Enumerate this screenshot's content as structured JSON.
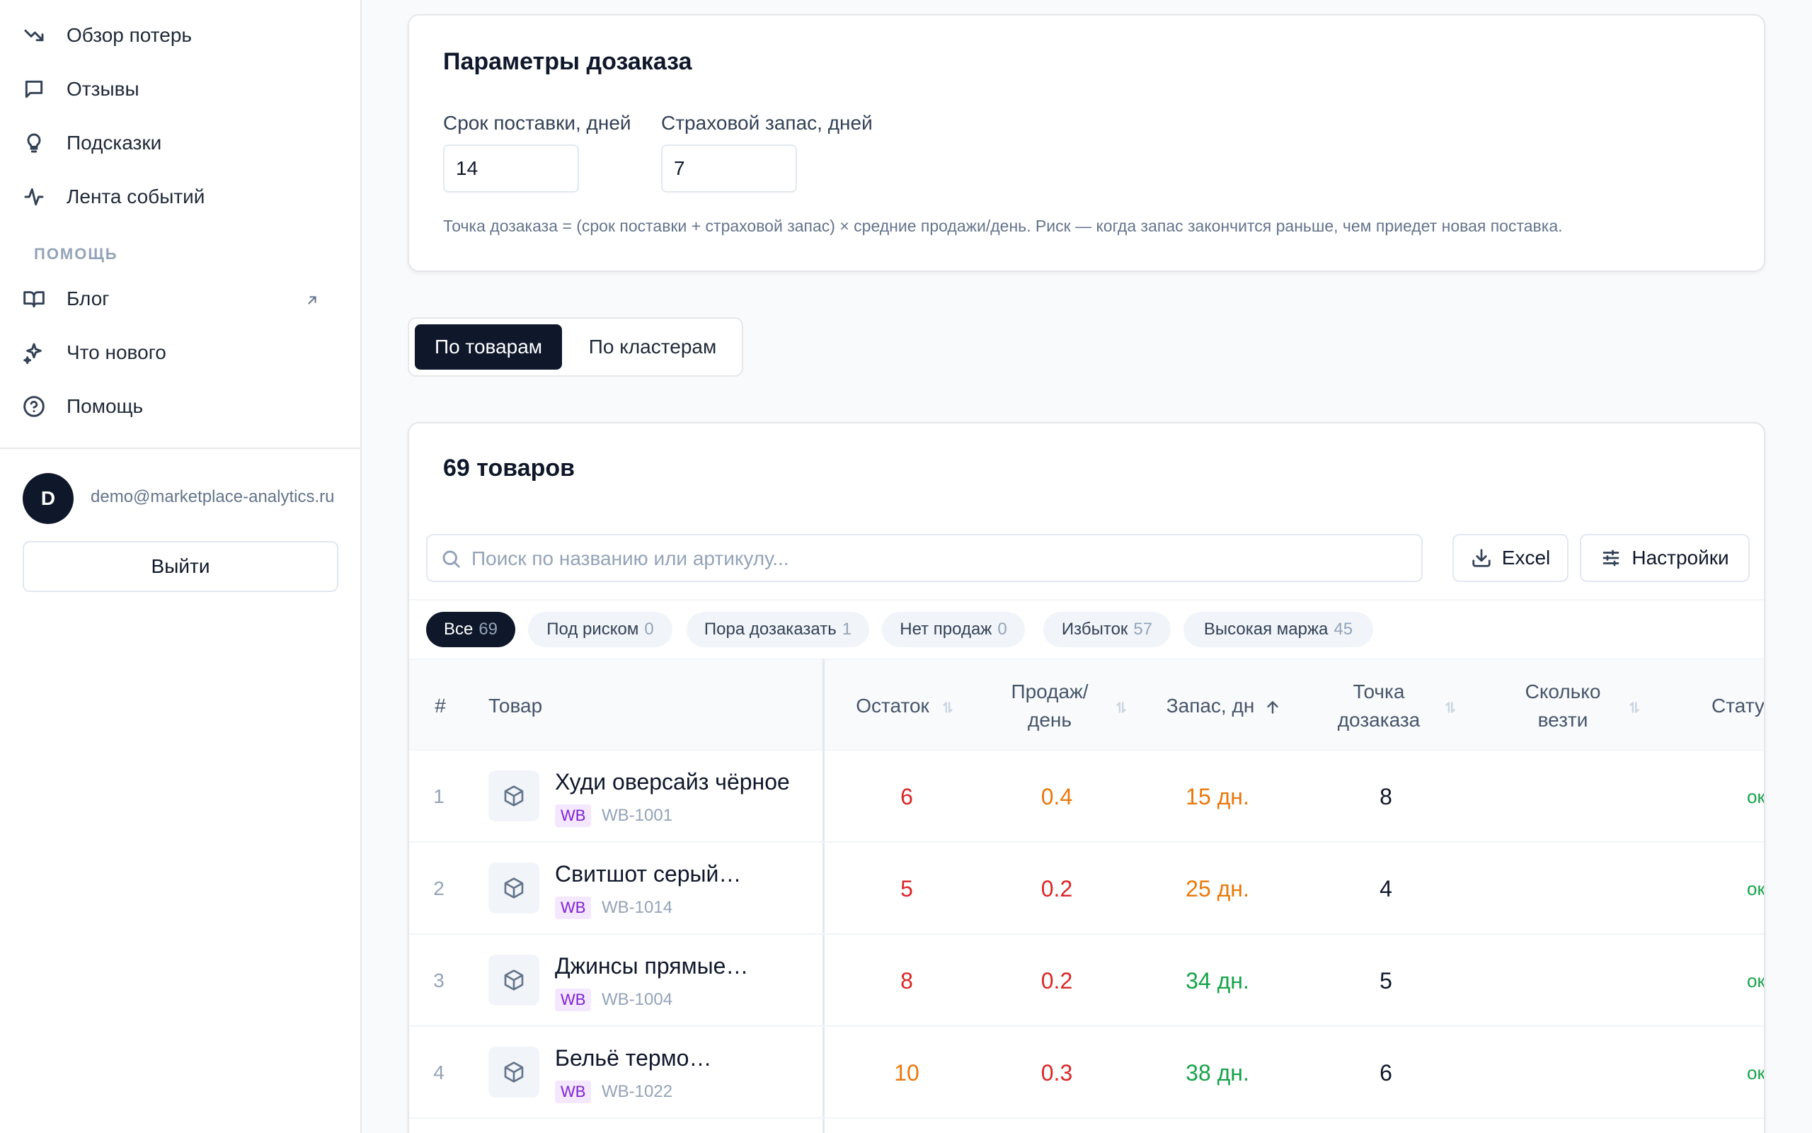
{
  "sidebar": {
    "nav": [
      {
        "label": "Обзор потерь",
        "icon": "trending-down-icon"
      },
      {
        "label": "Отзывы",
        "icon": "message-square-icon"
      },
      {
        "label": "Подсказки",
        "icon": "lightbulb-icon"
      },
      {
        "label": "Лента событий",
        "icon": "activity-icon"
      }
    ],
    "help_section_label": "ПОМОЩЬ",
    "help": [
      {
        "label": "Блог",
        "icon": "book-icon",
        "external": true
      },
      {
        "label": "Что нового",
        "icon": "sparkles-icon"
      },
      {
        "label": "Помощь",
        "icon": "help-circle-icon"
      }
    ],
    "user": {
      "initial": "D",
      "email": "demo@marketplace-analytics.ru"
    },
    "logout_label": "Выйти"
  },
  "params": {
    "title": "Параметры дозаказа",
    "lead_time_label": "Срок поставки, дней",
    "lead_time_value": "14",
    "safety_label": "Страховой запас, дней",
    "safety_value": "7",
    "hint": "Точка дозаказа = (срок поставки + страховой запас) × средние продажи/день. Риск — когда запас закончится раньше, чем приедет новая поставка."
  },
  "tabs": {
    "by_products": "По товарам",
    "by_clusters": "По кластерам"
  },
  "table": {
    "count_title": "69 товаров",
    "search_placeholder": "Поиск по названию или артикулу...",
    "excel_label": "Excel",
    "settings_label": "Настройки",
    "filters": [
      {
        "label": "Все",
        "count": "69",
        "active": true
      },
      {
        "label": "Под риском",
        "count": "0"
      },
      {
        "label": "Пора дозаказать",
        "count": "1"
      },
      {
        "label": "Нет продаж",
        "count": "0"
      },
      {
        "label": "Избыток",
        "count": "57"
      },
      {
        "label": "Высокая маржа",
        "count": "45"
      }
    ],
    "columns": {
      "num": "#",
      "product": "Товар",
      "stock": "Остаток",
      "sales": "Продаж/ день",
      "days": "Запас, дн",
      "reorder": "Точка дозаказа",
      "ship": "Сколько везти",
      "status": "Статус"
    },
    "rows": [
      {
        "num": "1",
        "name": "Худи оверсайз чёрное",
        "mp": "WB",
        "sku": "WB-1001",
        "stock": "6",
        "sales": "0.4",
        "days": "15 дн.",
        "reorder": "8",
        "ship": "",
        "status": "ок"
      },
      {
        "num": "2",
        "name": "Свитшот серый…",
        "mp": "WB",
        "sku": "WB-1014",
        "stock": "5",
        "sales": "0.2",
        "days": "25 дн.",
        "reorder": "4",
        "ship": "",
        "status": "ок"
      },
      {
        "num": "3",
        "name": "Джинсы прямые…",
        "mp": "WB",
        "sku": "WB-1004",
        "stock": "8",
        "sales": "0.2",
        "days": "34 дн.",
        "reorder": "5",
        "ship": "",
        "status": "ок"
      },
      {
        "num": "4",
        "name": "Бельё термо…",
        "mp": "WB",
        "sku": "WB-1022",
        "stock": "10",
        "sales": "0.3",
        "days": "38 дн.",
        "reorder": "6",
        "ship": "",
        "status": "ок"
      }
    ]
  },
  "colors": {
    "accent_dark": "#0f172a",
    "danger": "#dc2626",
    "warning": "#ea780c",
    "success": "#16a34a",
    "marketplace_badge": "#7e22ce"
  }
}
